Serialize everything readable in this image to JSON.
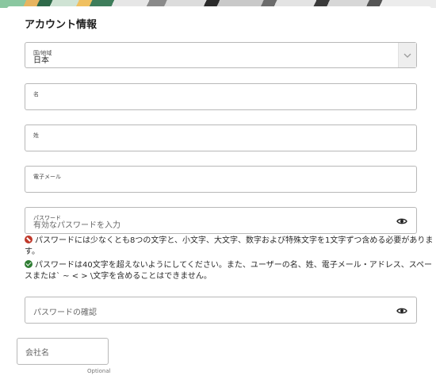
{
  "header": {
    "title": "アカウント情報"
  },
  "country": {
    "label": "国/地域",
    "value": "日本"
  },
  "first_name": {
    "label": "名"
  },
  "last_name": {
    "label": "姓"
  },
  "email": {
    "label": "電子メール"
  },
  "password": {
    "label": "パスワード",
    "placeholder": "有効なパスワードを入力",
    "toggle_icon": "eye-icon"
  },
  "password_rules": [
    {
      "status": "error",
      "icon": "prohibited-icon",
      "color": "#c0392b",
      "line1": "パスワードには少なくとも8つの文字と、小文字、大文字、数字および特殊文字を1文字ずつ含める必要がありま",
      "line2": "す。"
    },
    {
      "status": "ok",
      "icon": "check-circle-icon",
      "color": "#2e7d32",
      "line1": "パスワードは40文字を超えないようにしてください。また、ユーザーの名、姓、電子メール・アドレス、スペー",
      "line2": "スまたは` ~ < > \\文字を含めることはできません。"
    }
  ],
  "confirm_password": {
    "placeholder": "パスワードの確認",
    "toggle_icon": "eye-icon"
  },
  "company": {
    "placeholder": "会社名",
    "hint": "Optional"
  }
}
